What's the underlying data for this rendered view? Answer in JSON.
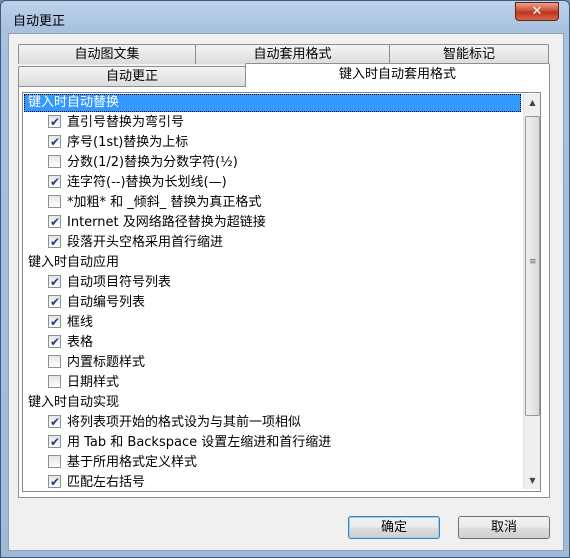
{
  "window": {
    "title": "自动更正",
    "close_glyph": "✕"
  },
  "tabs": {
    "back_row": [
      "自动图文集",
      "自动套用格式",
      "智能标记"
    ],
    "front_row": [
      "自动更正",
      "键入时自动套用格式"
    ],
    "active": "键入时自动套用格式"
  },
  "list": {
    "selected_header": "键入时自动替换",
    "groups": [
      {
        "label": "键入时自动替换",
        "options": [
          {
            "label": "直引号替换为弯引号",
            "checked": true
          },
          {
            "label": "序号(1st)替换为上标",
            "checked": true
          },
          {
            "label": "分数(1/2)替换为分数字符(½)",
            "checked": false
          },
          {
            "label": "连字符(--)替换为长划线(—)",
            "checked": true
          },
          {
            "label": "*加粗* 和 _倾斜_ 替换为真正格式",
            "checked": false
          },
          {
            "label": "Internet 及网络路径替换为超链接",
            "checked": true
          },
          {
            "label": "段落开头空格采用首行缩进",
            "checked": true
          }
        ]
      },
      {
        "label": "键入时自动应用",
        "options": [
          {
            "label": "自动项目符号列表",
            "checked": true
          },
          {
            "label": "自动编号列表",
            "checked": true
          },
          {
            "label": "框线",
            "checked": true
          },
          {
            "label": "表格",
            "checked": true
          },
          {
            "label": "内置标题样式",
            "checked": false
          },
          {
            "label": "日期样式",
            "checked": false
          }
        ]
      },
      {
        "label": "键入时自动实现",
        "options": [
          {
            "label": "将列表项开始的格式设为与其前一项相似",
            "checked": true
          },
          {
            "label": "用 Tab 和 Backspace 设置左缩进和首行缩进",
            "checked": true
          },
          {
            "label": "基于所用格式定义样式",
            "checked": false
          },
          {
            "label": "匹配左右括号",
            "checked": true
          }
        ]
      }
    ]
  },
  "buttons": {
    "ok": "确定",
    "cancel": "取消"
  },
  "colors": {
    "selection": "#3399ff",
    "title_bar": "#a7c1df",
    "close_button": "#c9472e"
  }
}
